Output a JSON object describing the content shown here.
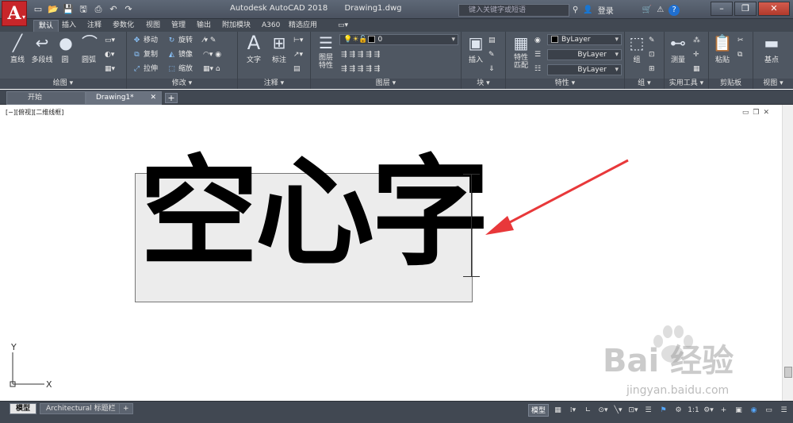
{
  "app": {
    "logo": "A",
    "title": "Autodesk AutoCAD 2018",
    "document": "Drawing1.dwg",
    "search_placeholder": "键入关键字或短语",
    "login": "登录",
    "help": "?"
  },
  "quick_access": [
    "new-icon",
    "open-icon",
    "save-icon",
    "saveas-icon",
    "print-icon",
    "undo-icon",
    "redo-icon"
  ],
  "ribbon_tabs": [
    "默认",
    "插入",
    "注释",
    "参数化",
    "视图",
    "管理",
    "输出",
    "附加模块",
    "A360",
    "精选应用"
  ],
  "panels": {
    "draw": {
      "label": "绘图 ▾",
      "line": "直线",
      "polyline": "多段线",
      "circle": "圆",
      "arc": "圆弧"
    },
    "modify": {
      "label": "修改 ▾",
      "move": "移动",
      "rotate": "旋转",
      "copy": "复制",
      "mirror": "镜像",
      "stretch": "拉伸",
      "scale": "缩放"
    },
    "annotation": {
      "label": "注释 ▾",
      "text": "文字",
      "dimension": "标注"
    },
    "layers": {
      "label": "图层 ▾",
      "layer_props": "图层\n特性",
      "layer_value": "0"
    },
    "block": {
      "label": "块 ▾",
      "insert": "插入"
    },
    "properties": {
      "label": "特性 ▾",
      "match": "特性\n匹配",
      "color": "ByLayer",
      "linetype": "ByLayer",
      "lineweight": "ByLayer"
    },
    "groups": {
      "label": "组 ▾",
      "group": "组"
    },
    "utilities": {
      "label": "实用工具 ▾",
      "measure": "测量"
    },
    "clipboard": {
      "label": "剪贴板",
      "paste": "粘贴"
    },
    "view": {
      "label": "视图 ▾",
      "base": "基点"
    }
  },
  "file_tabs": {
    "start": "开始",
    "drawing": "Drawing1*"
  },
  "viewport": {
    "label": "[−][俯视][二维线框]"
  },
  "canvas_text": "空心字",
  "ucs": {
    "x": "X",
    "y": "Y"
  },
  "watermark": {
    "main": "Bai  经验",
    "sub": "jingyan.baidu.com"
  },
  "layout_tabs": [
    "模型",
    "Architectural 标题栏"
  ],
  "status": {
    "model": "模型",
    "scale": "1:1"
  }
}
